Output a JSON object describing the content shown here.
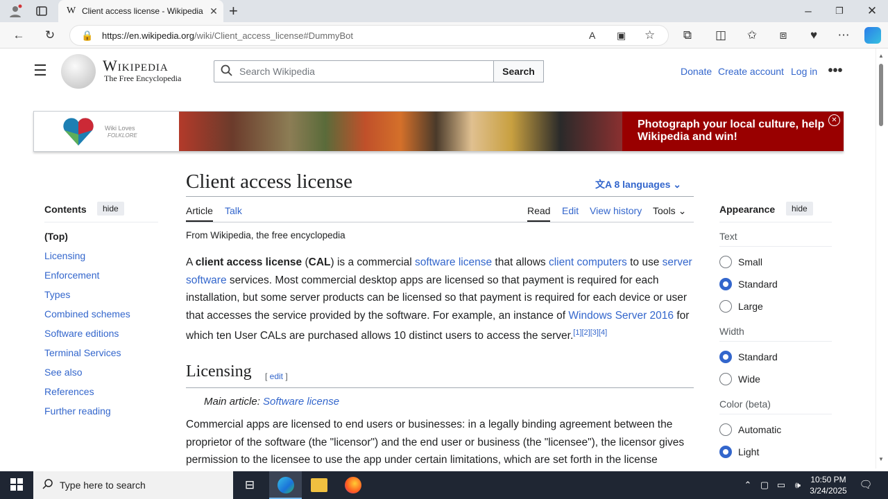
{
  "browser": {
    "tab_title": "Client access license - Wikipedia",
    "url_domain": "https://en.wikipedia.org",
    "url_path": "/wiki/Client_access_license#DummyBot"
  },
  "header": {
    "logo_title": "Wikipedia",
    "logo_subtitle": "The Free Encyclopedia",
    "search_placeholder": "Search Wikipedia",
    "search_button": "Search",
    "links": [
      "Donate",
      "Create account",
      "Log in"
    ]
  },
  "banner": {
    "campaign_line1": "Wiki Loves",
    "campaign_line2": "FOLKLORE",
    "message": "Photograph your local culture, help Wikipedia and win!"
  },
  "toc": {
    "title": "Contents",
    "hide_label": "hide",
    "items": [
      "(Top)",
      "Licensing",
      "Enforcement",
      "Types",
      "Combined schemes",
      "Software editions",
      "Terminal Services",
      "See also",
      "References",
      "Further reading"
    ]
  },
  "article": {
    "title": "Client access license",
    "languages": "8 languages",
    "tabs_left": [
      "Article",
      "Talk"
    ],
    "tabs_right": [
      "Read",
      "Edit",
      "View history",
      "Tools"
    ],
    "from": "From Wikipedia, the free encyclopedia",
    "intro": {
      "t1": "A ",
      "b1": "client access license",
      "t2": " (",
      "b2": "CAL",
      "t3": ") is a commercial ",
      "l1": "software license",
      "t4": " that allows ",
      "l2": "client computers",
      "t5": " to use ",
      "l3": "server software",
      "t6": " services. Most commercial desktop apps are licensed so that payment is required for each installation, but some server products can be licensed so that payment is required for each device or user that accesses the service provided by the software. For example, an instance of ",
      "l4": "Windows Server 2016",
      "t7": " for which ten User CALs are purchased allows 10 distinct users to access the server.",
      "refs": "[1][2][3][4]"
    },
    "section1_title": "Licensing",
    "section1_edit": "edit",
    "main_article_label": "Main article: ",
    "main_article_link": "Software license",
    "section1_text": "Commercial apps are licensed to end users or businesses: in a legally binding agreement between the proprietor of the software (the \"licensor\") and the end user or business (the \"licensee\"), the licensor gives permission to the licensee to use the app under certain limitations, which are set forth in the license"
  },
  "appearance": {
    "title": "Appearance",
    "hide_label": "hide",
    "text_label": "Text",
    "text_options": [
      "Small",
      "Standard",
      "Large"
    ],
    "text_selected": "Standard",
    "width_label": "Width",
    "width_options": [
      "Standard",
      "Wide"
    ],
    "width_selected": "Standard",
    "color_label": "Color (beta)",
    "color_options": [
      "Automatic",
      "Light"
    ],
    "color_selected": "Light"
  },
  "taskbar": {
    "search_placeholder": "Type here to search",
    "time": "10:50 PM",
    "date": "3/24/2025"
  },
  "colors": {
    "link": "#3366cc",
    "banner": "#990000",
    "taskbar": "#1f2633"
  }
}
